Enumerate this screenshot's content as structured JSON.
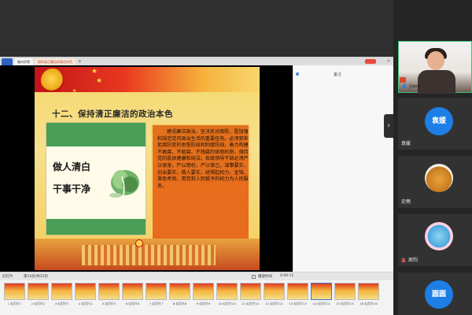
{
  "window": {
    "tab_logo": "",
    "tab1": "福州学院",
    "tab2": "保持清正廉洁的政治本色",
    "tab_plus": "+"
  },
  "slide": {
    "title": "十二、保持清正廉洁的政治本色",
    "calligraphy": "做人清白 干事干净",
    "body": "建设廉洁政治，坚决反对腐败，是加强和规范党内政治生活的重要任务。必须筑牢拒腐防变的思想防线和制度防线，着力构建不敢腐、不能腐、不想腐的体制机制，保持党的肌体健康和纯洁。各级领导干部必须严以修身，严以用权，严以律己，谋事要实、创业要实、做人要实，经得起权力、金钱、美色考验，用党和人民赋予的权力为人民服务。"
  },
  "note_panel": {
    "heading": "",
    "right_label": "备注"
  },
  "filmstrip": {
    "header_left": "幻灯片",
    "header_mid": "第14页/共33页",
    "header_right": "播放时间",
    "timer": "0:00:11",
    "thumbs": [
      {
        "label": "1 幻灯片1"
      },
      {
        "label": "2 幻灯片2"
      },
      {
        "label": "3 幻灯片3"
      },
      {
        "label": "4 幻灯片4"
      },
      {
        "label": "5 幻灯片5"
      },
      {
        "label": "6 幻灯片6"
      },
      {
        "label": "7 幻灯片7"
      },
      {
        "label": "8 幻灯片8"
      },
      {
        "label": "9 幻灯片9"
      },
      {
        "label": "10 幻灯片10"
      },
      {
        "label": "11 幻灯片11"
      },
      {
        "label": "12 幻灯片12"
      },
      {
        "label": "13 幻灯片13"
      },
      {
        "label": "14 幻灯片14"
      },
      {
        "label": "15 幻灯片15"
      },
      {
        "label": "16 幻灯片16"
      }
    ]
  },
  "participants": {
    "p1": {
      "name": "jiaoe"
    },
    "p2": {
      "name": "袁媛",
      "avatar": "袁媛"
    },
    "p3": {
      "name": "史畅"
    },
    "p4": {
      "name": "周钧"
    },
    "p5": {
      "avatar": "圆圆"
    }
  },
  "colors": {
    "accent_blue": "#1d7ee6",
    "active_speaker": "#3fbf7f",
    "slide_red": "#c2141a",
    "slide_orange": "#e96b1e"
  }
}
